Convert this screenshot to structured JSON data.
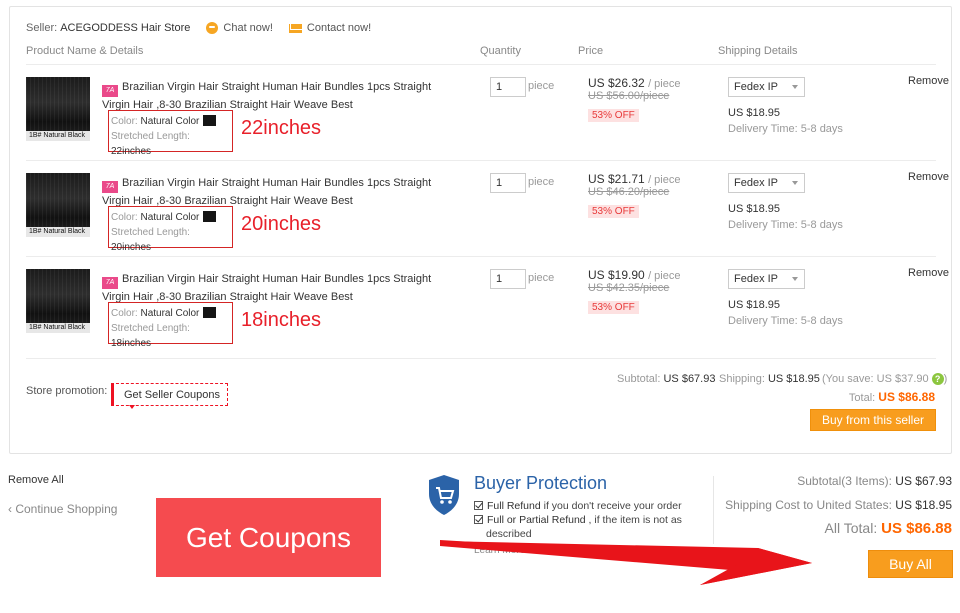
{
  "seller": {
    "label": "Seller:",
    "name": "ACEGODDESS Hair Store",
    "chat": "Chat now!",
    "contact": "Contact now!"
  },
  "columns": {
    "product": "Product Name & Details",
    "quantity": "Quantity",
    "price": "Price",
    "shipping": "Shipping Details"
  },
  "items": [
    {
      "thumb_caption": "1B#  Natural Black",
      "brand_badge": "7A",
      "title": "Brazilian Virgin Hair Straight Human Hair Bundles 1pcs Straight Virgin Hair ,8-30 Brazilian Straight Hair Weave Best",
      "color_label": "Color:",
      "color_value": "Natural Color",
      "length_label": "Stretched Length:",
      "length_value": "22inches",
      "annotation": "22inches",
      "qty": "1",
      "qty_unit": "piece",
      "price": "US $26.32",
      "price_unit": "/ piece",
      "old_price": "US $56.00/piece",
      "discount": "53% OFF",
      "ship_method": "Fedex IP",
      "ship_cost": "US $18.95",
      "delivery": "Delivery Time: 5-8 days",
      "remove": "Remove"
    },
    {
      "thumb_caption": "1B#  Natural Black",
      "brand_badge": "7A",
      "title": "Brazilian Virgin Hair Straight Human Hair Bundles 1pcs Straight Virgin Hair ,8-30 Brazilian Straight Hair Weave Best",
      "color_label": "Color:",
      "color_value": "Natural Color",
      "length_label": "Stretched Length:",
      "length_value": "20inches",
      "annotation": "20inches",
      "qty": "1",
      "qty_unit": "piece",
      "price": "US $21.71",
      "price_unit": "/ piece",
      "old_price": "US $46.20/piece",
      "discount": "53% OFF",
      "ship_method": "Fedex IP",
      "ship_cost": "US $18.95",
      "delivery": "Delivery Time: 5-8 days",
      "remove": "Remove"
    },
    {
      "thumb_caption": "1B#  Natural Black",
      "brand_badge": "7A",
      "title": "Brazilian Virgin Hair Straight Human Hair Bundles 1pcs Straight Virgin Hair ,8-30 Brazilian Straight Hair Weave Best",
      "color_label": "Color:",
      "color_value": "Natural Color",
      "length_label": "Stretched Length:",
      "length_value": "18inches",
      "annotation": "18inches",
      "qty": "1",
      "qty_unit": "piece",
      "price": "US $19.90",
      "price_unit": "/ piece",
      "old_price": "US $42.35/piece",
      "discount": "53% OFF",
      "ship_method": "Fedex IP",
      "ship_cost": "US $18.95",
      "delivery": "Delivery Time: 5-8 days",
      "remove": "Remove"
    }
  ],
  "store_summary": {
    "promo_label": "Store promotion:",
    "promo_button": "Get Seller Coupons",
    "subtotal_label": "Subtotal:",
    "subtotal": "US $67.93",
    "shipping_label": "Shipping:",
    "shipping": "US $18.95",
    "save": "(You save: US $37.90",
    "save_close": ")",
    "help_icon": "?",
    "total_label": "Total:",
    "total": "US $86.88",
    "buy_button": "Buy from this seller"
  },
  "footer": {
    "remove_all": "Remove All",
    "continue": "‹ Continue Shopping",
    "coupon_banner": "Get Coupons",
    "buyer_protection": {
      "title": "Buyer Protection",
      "item1_bold": "Full Refund",
      "item1_rest": " if you don't receive your order",
      "item2_bold": "Full or Partial Refund",
      "item2_rest": " , if the item is not as",
      "item2_line2": "described",
      "learn_more": "Learn More ▾"
    },
    "subtotal_label": "Subtotal(3 Items):",
    "subtotal": "US $67.93",
    "shipping_label": "Shipping Cost to United States:",
    "shipping": "US $18.95",
    "all_total_label": "All Total:",
    "all_total": "US $86.88",
    "buy_all": "Buy All"
  },
  "colors": {
    "accent_orange": "#f89d1e",
    "price_orange": "#ff6600",
    "annotation_red": "#e8202a",
    "banner_red": "#f54b4f",
    "protection_blue": "#2b63a8"
  }
}
